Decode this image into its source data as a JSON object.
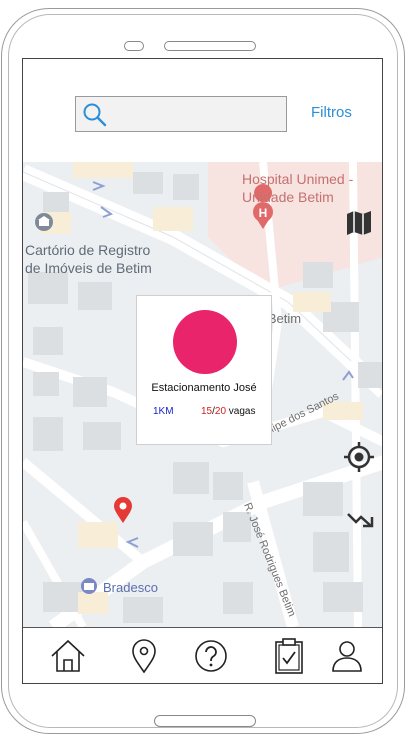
{
  "header": {
    "search_placeholder": "",
    "filters_label": "Filtros"
  },
  "map": {
    "poi_hospital": "Hospital Unimed -\nUnidade Betim",
    "poi_cartorio": "Cartório de Registro\nde Imóveis de Betim",
    "poi_bradesco": "Bradesco",
    "street_betim": "a Betim",
    "street_felipe": "R. Felipe dos Santos",
    "street_jose": "R. José Rodrigues Betim"
  },
  "parking_card": {
    "name": "Estacionamento José",
    "distance": "1KM",
    "occupied": "15",
    "separator": "/",
    "total": "20",
    "spots_label": " vagas",
    "avatar_color": "#e9246a"
  },
  "icons": {
    "search": "search-icon",
    "map_layers": "map-icon",
    "my_location": "crosshair-icon",
    "route": "route-arrow-icon",
    "home": "home-icon",
    "pin": "location-pin-icon",
    "help": "help-icon",
    "checklist": "clipboard-icon",
    "profile": "user-icon"
  },
  "colors": {
    "accent": "#2a8fd8",
    "marker": "#e53935"
  }
}
